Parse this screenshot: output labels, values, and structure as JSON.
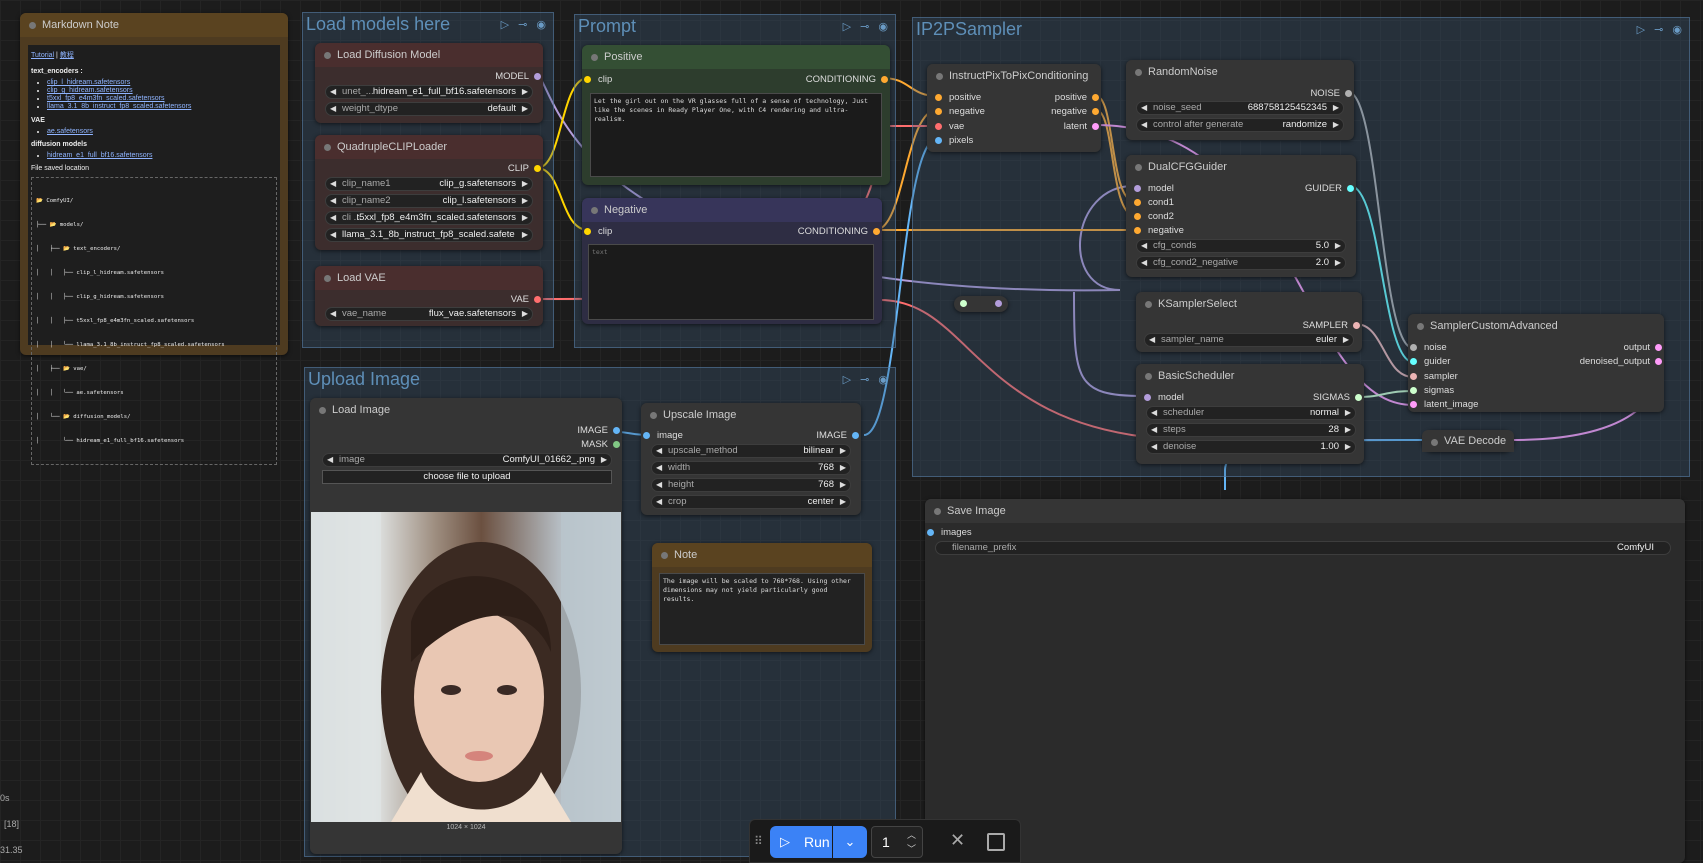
{
  "groups": {
    "load_models": {
      "title": "Load models here"
    },
    "prompt": {
      "title": "Prompt"
    },
    "ip2p": {
      "title": "IP2PSampler"
    },
    "upload": {
      "title": "Upload Image"
    }
  },
  "markdown_note": {
    "title": "Markdown Note",
    "links": {
      "tutorial": "Tutorial",
      "sep": "|",
      "cn": "教程"
    },
    "text_encoders_heading": "text_encoders :",
    "text_encoders": [
      "clip_l_hidream.safetensors",
      "clip_g_hidream.safetensors",
      "t5xxl_fp8_e4m3fn_scaled.safetensors",
      "llama_3.1_8b_instruct_fp8_scaled.safetensors"
    ],
    "vae_heading": "VAE",
    "vae_files": [
      "ae.safetensors"
    ],
    "diffusion_heading": "diffusion models",
    "diffusion_files": [
      "hidream_e1_full_bf16.safetensors"
    ],
    "location_heading": "File saved location",
    "tree": [
      "📂 ComfyUI/",
      "├── 📂 models/",
      "│   ├── 📂 text_encoders/",
      "│   │   ├── clip_l_hidream.safetensors",
      "│   │   ├── clip_g_hidream.safetensors",
      "│   │   ├── t5xxl_fp8_e4m3fn_scaled.safetensors",
      "│   │   └── llama_3.1_8b_instruct_fp8_scaled.safetensors",
      "│   ├── 📂 vae/",
      "│   │   └── ae.safetensors",
      "│   └── 📂 diffusion_models/",
      "│       └── hidream_e1_full_bf16.safetensors"
    ]
  },
  "load_diffusion": {
    "title": "Load Diffusion Model",
    "out": "MODEL",
    "w1_label": "unet_...",
    "w1_value": "hidream_e1_full_bf16.safetensors",
    "w2_label": "weight_dtype",
    "w2_value": "default"
  },
  "clip_loader": {
    "title": "QuadrupleCLIPLoader",
    "out": "CLIP",
    "w1_label": "clip_name1",
    "w1_value": "clip_g.safetensors",
    "w2_label": "clip_name2",
    "w2_value": "clip_l.safetensors",
    "w3_label": "cli ...",
    "w3_value": "t5xxl_fp8_e4m3fn_scaled.safetensors",
    "w4_value": "llama_3.1_8b_instruct_fp8_scaled.safete ..."
  },
  "load_vae": {
    "title": "Load VAE",
    "out": "VAE",
    "w1_label": "vae_name",
    "w1_value": "flux_vae.safetensors"
  },
  "positive": {
    "title": "Positive",
    "in": "clip",
    "out": "CONDITIONING",
    "text": "Let the girl out on the VR glasses full of a sense of technology, Just like the scenes in Ready Player One, with C4 rendering and ultra-realism."
  },
  "negative": {
    "title": "Negative",
    "in": "clip",
    "out": "CONDITIONING",
    "placeholder": "text"
  },
  "ip2p_cond": {
    "title": "InstructPixToPixConditioning",
    "in1": "positive",
    "in2": "negative",
    "in3": "vae",
    "in4": "pixels",
    "out1": "positive",
    "out2": "negative",
    "out3": "latent"
  },
  "random_noise": {
    "title": "RandomNoise",
    "out": "NOISE",
    "w1_label": "noise_seed",
    "w1_value": "688758125452345",
    "w2_label": "control after generate",
    "w2_value": "randomize"
  },
  "dual_cfg": {
    "title": "DualCFGGuider",
    "in1": "model",
    "in2": "cond1",
    "in3": "cond2",
    "in4": "negative",
    "out": "GUIDER",
    "w1_label": "cfg_conds",
    "w1_value": "5.0",
    "w2_label": "cfg_cond2_negative",
    "w2_value": "2.0"
  },
  "ksampler_select": {
    "title": "KSamplerSelect",
    "out": "SAMPLER",
    "w1_label": "sampler_name",
    "w1_value": "euler"
  },
  "basic_scheduler": {
    "title": "BasicScheduler",
    "in": "model",
    "out": "SIGMAS",
    "w1_label": "scheduler",
    "w1_value": "normal",
    "w2_label": "steps",
    "w2_value": "28",
    "w3_label": "denoise",
    "w3_value": "1.00"
  },
  "sampler_custom": {
    "title": "SamplerCustomAdvanced",
    "in1": "noise",
    "in2": "guider",
    "in3": "sampler",
    "in4": "sigmas",
    "in5": "latent_image",
    "out1": "output",
    "out2": "denoised_output"
  },
  "vae_decode": {
    "title": "VAE Decode"
  },
  "save_image": {
    "title": "Save Image",
    "in": "images",
    "w1_label": "filename_prefix",
    "w1_value": "ComfyUI"
  },
  "load_image": {
    "title": "Load Image",
    "out1": "IMAGE",
    "out2": "MASK",
    "w1_label": "image",
    "w1_value": "ComfyUI_01662_.png",
    "upload_label": "choose file to upload",
    "dims": "1024 × 1024"
  },
  "upscale_image": {
    "title": "Upscale Image",
    "in": "image",
    "out": "IMAGE",
    "w1_label": "upscale_method",
    "w1_value": "bilinear",
    "w2_label": "width",
    "w2_value": "768",
    "w3_label": "height",
    "w3_value": "768",
    "w4_label": "crop",
    "w4_value": "center"
  },
  "note": {
    "title": "Note",
    "text": "The image will be scaled to 768*768. Using other dimensions may not yield particularly good results."
  },
  "toolbar": {
    "run_label": "Run",
    "batch_count": "1"
  },
  "side_stats": {
    "s1": "0s",
    "s2": "[18]",
    "s3": "31.35"
  },
  "colors": {
    "model": "#b39ddb",
    "clip": "#ffd500",
    "conditioning": "#ffa931",
    "vae": "#ff6e6e",
    "image": "#64b5f6",
    "latent": "#ff9cf9",
    "noise": "#b0b0b0",
    "guider": "#66ffff",
    "sampler": "#ecb4b4",
    "sigmas": "#cdffcd"
  }
}
